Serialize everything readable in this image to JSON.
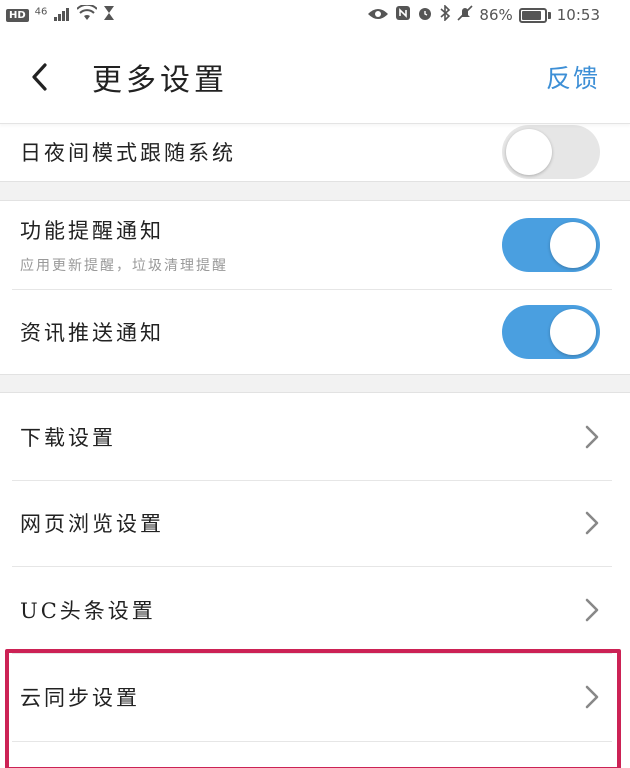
{
  "status_bar": {
    "hd": "HD",
    "network": "46",
    "battery_percent": "86%",
    "battery_level": 0.86,
    "time": "10:53",
    "icons": [
      "signal-icon",
      "wifi-icon",
      "hourglass-icon",
      "eye-icon",
      "nfc-icon",
      "alarm-icon",
      "bluetooth-icon",
      "mute-icon",
      "battery-icon"
    ]
  },
  "header": {
    "title": "更多设置",
    "feedback_label": "反馈"
  },
  "settings": {
    "day_night": {
      "label": "日夜间模式跟随系统",
      "enabled": false
    },
    "feature_notify": {
      "label": "功能提醒通知",
      "subtitle": "应用更新提醒，垃圾清理提醒",
      "enabled": true
    },
    "news_push": {
      "label": "资讯推送通知",
      "enabled": true
    },
    "download": {
      "label": "下载设置"
    },
    "web_browse": {
      "label": "网页浏览设置"
    },
    "uc_headline": {
      "label": "UC头条设置"
    },
    "cloud_sync": {
      "label": "云同步设置"
    }
  },
  "colors": {
    "accent": "#4a9fe0",
    "feedback": "#3d8fd6",
    "highlight": "#cc2255"
  }
}
